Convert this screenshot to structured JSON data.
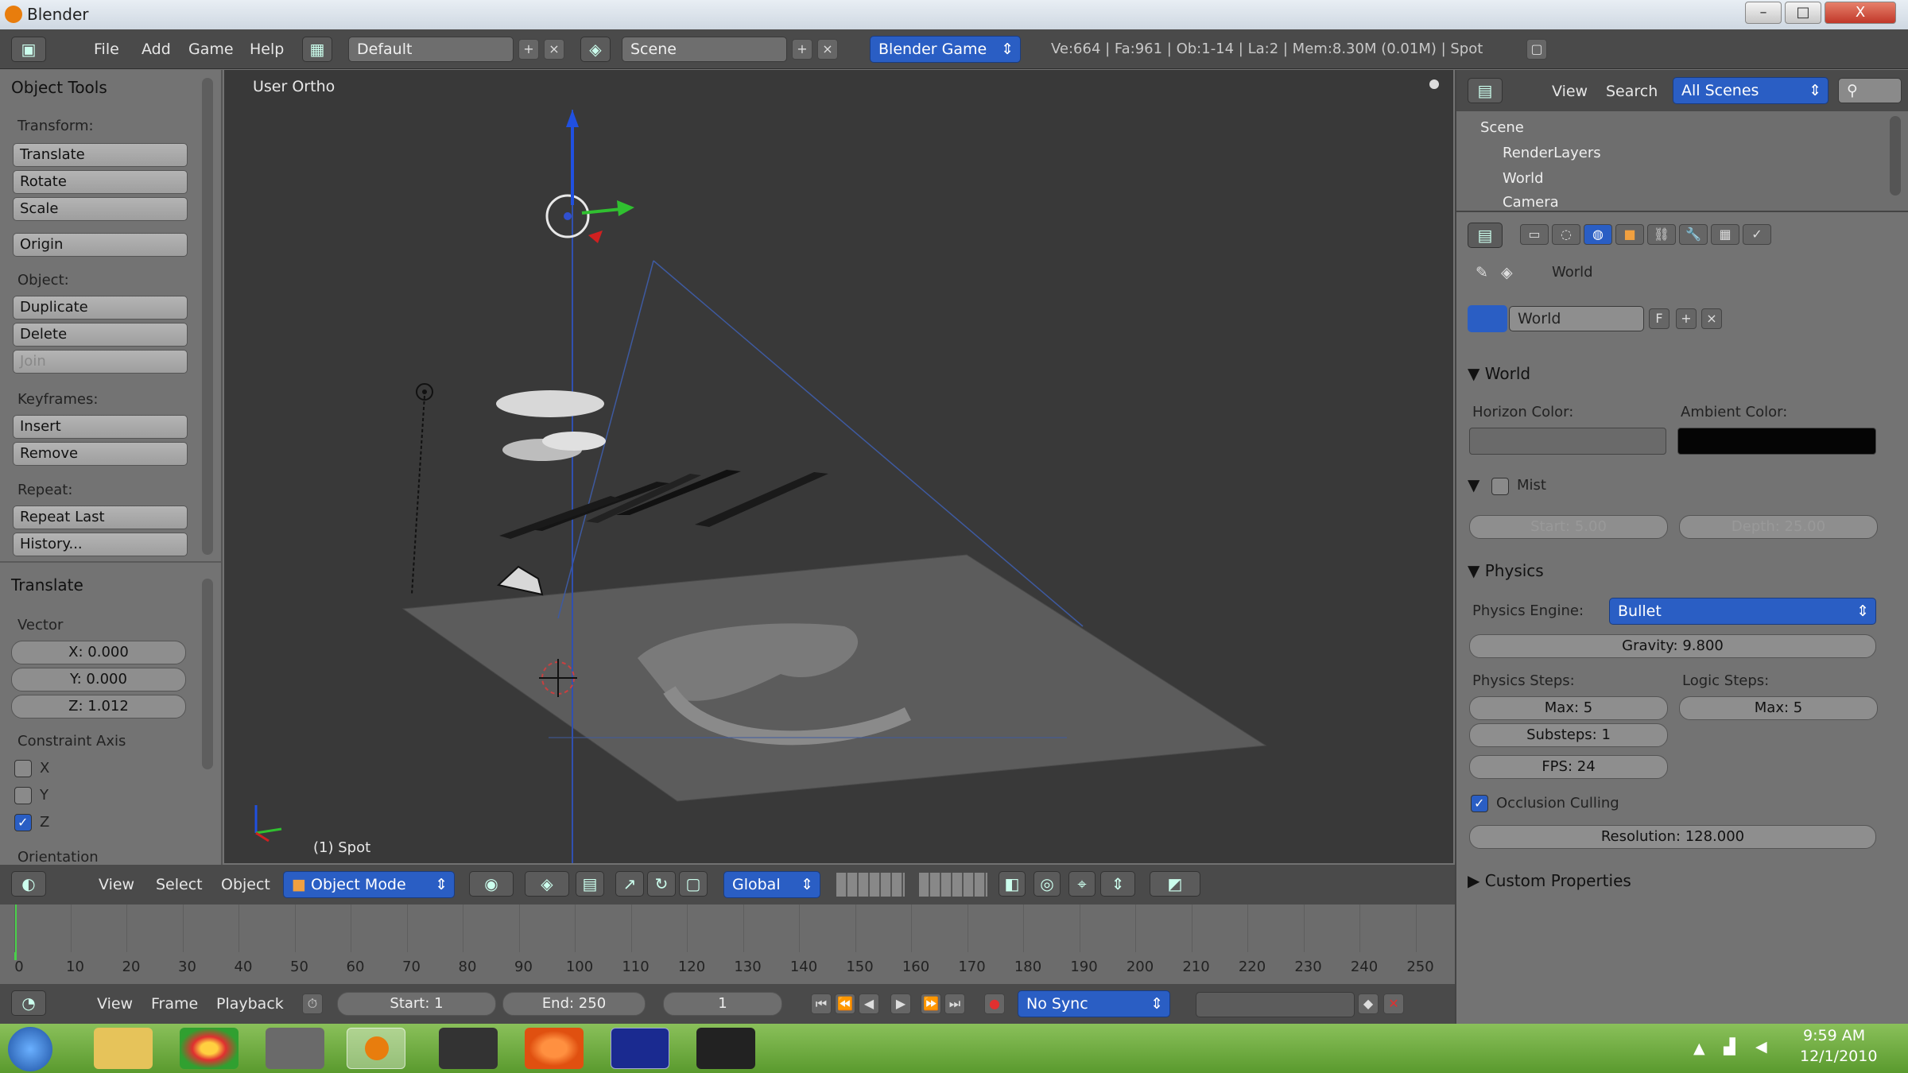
{
  "window": {
    "title": "Blender",
    "min": "–",
    "max": "□",
    "close": "X"
  },
  "menu": {
    "file": "File",
    "add": "Add",
    "game": "Game",
    "help": "Help",
    "layout": "Default",
    "scene": "Scene",
    "engine": "Blender Game",
    "stats": "Ve:664 | Fa:961 | Ob:1-14 | La:2 | Mem:8.30M (0.01M) | Spot"
  },
  "tools": {
    "object_tools": "Object Tools",
    "transform": "Transform:",
    "translate": "Translate",
    "rotate": "Rotate",
    "scale": "Scale",
    "origin": "Origin",
    "object": "Object:",
    "duplicate": "Duplicate",
    "delete": "Delete",
    "join": "Join",
    "keyframes": "Keyframes:",
    "insert": "Insert",
    "remove": "Remove",
    "repeat": "Repeat:",
    "repeat_last": "Repeat Last",
    "history": "History...",
    "translate_panel": "Translate",
    "vector": "Vector",
    "x": "X: 0.000",
    "y": "Y: 0.000",
    "z": "Z: 1.012",
    "constraint_axis": "Constraint Axis",
    "cx": "X",
    "cy": "Y",
    "cz": "Z",
    "orientation": "Orientation"
  },
  "viewport": {
    "label": "User Ortho",
    "object_label": "(1) Spot"
  },
  "vheader": {
    "view": "View",
    "select": "Select",
    "object": "Object",
    "mode": "Object Mode",
    "orientation": "Global"
  },
  "timeline": {
    "ticks": [
      "0",
      "10",
      "20",
      "30",
      "40",
      "50",
      "60",
      "70",
      "80",
      "90",
      "100",
      "110",
      "120",
      "130",
      "140",
      "150",
      "160",
      "170",
      "180",
      "190",
      "200",
      "210",
      "220",
      "230",
      "240",
      "250"
    ]
  },
  "tlfooter": {
    "view": "View",
    "frame": "Frame",
    "playback": "Playback",
    "start": "Start: 1",
    "end": "End: 250",
    "current": "1",
    "sync": "No Sync"
  },
  "outliner": {
    "view": "View",
    "search": "Search",
    "scenes": "All Scenes",
    "items": [
      "Scene",
      "RenderLayers",
      "World",
      "Camera"
    ]
  },
  "props": {
    "breadcrumb": "World",
    "world_name": "World",
    "f": "F",
    "world_panel": "World",
    "horizon_color": "Horizon Color:",
    "ambient_color": "Ambient Color:",
    "mist": "Mist",
    "mist_start": "Start: 5.00",
    "mist_depth": "Depth: 25.00",
    "physics": "Physics",
    "physics_engine_label": "Physics Engine:",
    "physics_engine": "Bullet",
    "gravity": "Gravity: 9.800",
    "physics_steps": "Physics Steps:",
    "logic_steps": "Logic Steps:",
    "max1": "Max: 5",
    "max2": "Max: 5",
    "substeps": "Substeps: 1",
    "fps": "FPS: 24",
    "occlusion": "Occlusion Culling",
    "resolution": "Resolution: 128.000",
    "custom": "Custom Properties"
  },
  "clock": {
    "time": "9:59 AM",
    "date": "12/1/2010"
  },
  "colors": {
    "horizon": "#6a6a6a",
    "ambient": "#050505",
    "accent": "#2a5ec4"
  }
}
